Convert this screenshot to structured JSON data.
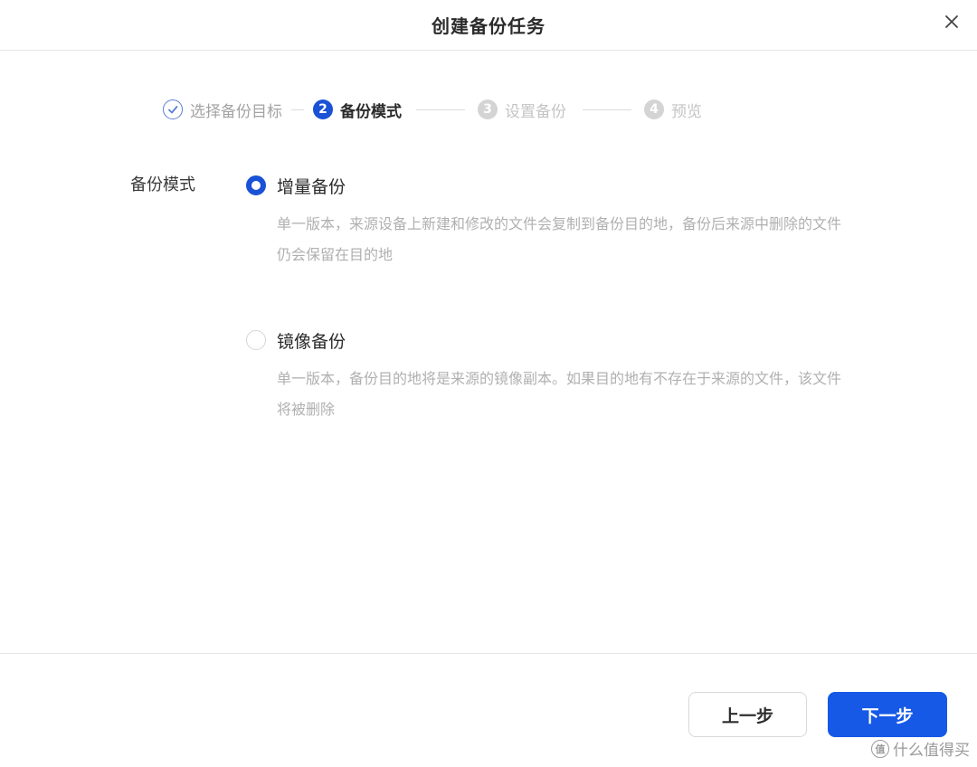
{
  "dialog": {
    "title": "创建备份任务",
    "close_icon": "close-icon"
  },
  "stepper": {
    "steps": [
      {
        "index": "✓",
        "label": "选择备份目标",
        "state": "done"
      },
      {
        "index": "2",
        "label": "备份模式",
        "state": "active"
      },
      {
        "index": "3",
        "label": "设置备份",
        "state": "pending"
      },
      {
        "index": "4",
        "label": "预览",
        "state": "pending"
      }
    ]
  },
  "form": {
    "label": "备份模式",
    "options": [
      {
        "label": "增量备份",
        "description": "单一版本，来源设备上新建和修改的文件会复制到备份目的地，备份后来源中删除的文件仍会保留在目的地",
        "selected": true
      },
      {
        "label": "镜像备份",
        "description": "单一版本，备份目的地将是来源的镜像副本。如果目的地有不存在于来源的文件，该文件将被删除",
        "selected": false
      }
    ]
  },
  "footer": {
    "prev_label": "上一步",
    "next_label": "下一步"
  },
  "watermark": {
    "badge": "值",
    "text": "什么值得买"
  },
  "colors": {
    "primary": "#1659e6",
    "step_active": "#1a52d6",
    "muted_text": "#b0b0b0"
  }
}
